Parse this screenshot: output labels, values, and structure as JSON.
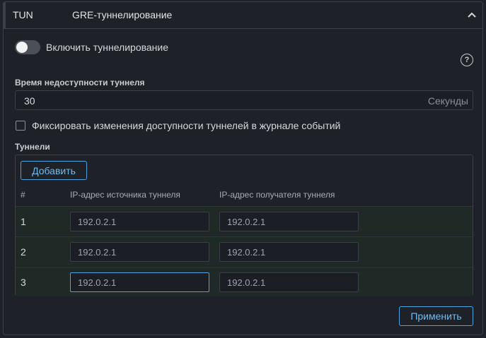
{
  "header": {
    "tag": "TUN",
    "title": "GRE-туннелирование"
  },
  "toggle": {
    "label": "Включить туннелирование",
    "enabled": false
  },
  "timeout": {
    "label": "Время недоступности туннеля",
    "value": "30",
    "unit": "Секунды"
  },
  "log_checkbox": {
    "label": "Фиксировать изменения доступности туннелей в журнале событий",
    "checked": false
  },
  "tunnels": {
    "label": "Туннели",
    "add_label": "Добавить",
    "columns": [
      "#",
      "IP-адрес источника туннеля",
      "IP-адрес получателя туннеля"
    ],
    "rows": [
      {
        "num": "1",
        "source_placeholder": "192.0.2.1",
        "dest_placeholder": "192.0.2.1"
      },
      {
        "num": "2",
        "source_placeholder": "192.0.2.1",
        "dest_placeholder": "192.0.2.1"
      },
      {
        "num": "3",
        "source_placeholder": "192.0.2.1",
        "dest_placeholder": "192.0.2.1"
      }
    ]
  },
  "apply_label": "Применить",
  "help_symbol": "?",
  "colors": {
    "accent": "#4aa3df",
    "background": "#1e2128",
    "row_bg": "#1f2a27"
  }
}
